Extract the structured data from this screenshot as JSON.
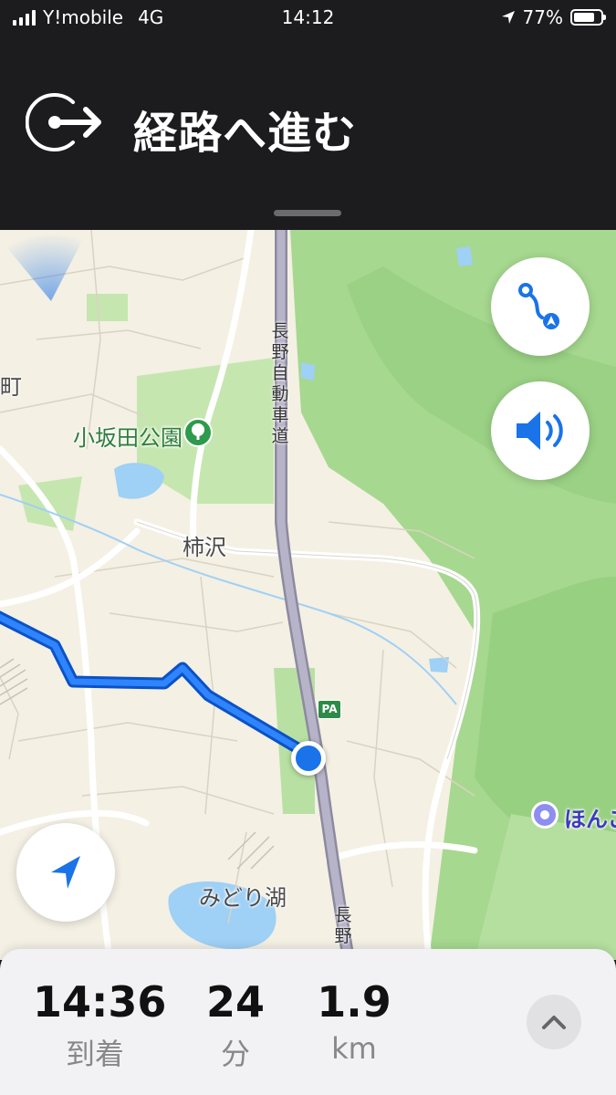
{
  "status_bar": {
    "carrier": "Y!mobile",
    "network": "4G",
    "time": "14:12",
    "battery_percent": "77%",
    "battery_level": 0.77
  },
  "navigation": {
    "instruction": "経路へ進む",
    "icon": "proceed-to-route-icon"
  },
  "map": {
    "labels": {
      "park": "小坂田公園",
      "area_kakizawa": "柿沢",
      "lake_midori": "みどり湖",
      "town_partial": "町",
      "expressway_1": "長野自動車道",
      "expressway_2": "長野",
      "poi_partial": "ほんご",
      "pa_badge": "PA"
    },
    "colors": {
      "route": "#1a73e8",
      "expressway": "#a9a5b8",
      "forest": "#a6d88f",
      "park": "#c6e6b0",
      "water": "#9fd0f5"
    }
  },
  "buttons": {
    "route_overview_icon": "route-overview-icon",
    "audio_icon": "speaker-icon",
    "locate_icon": "location-arrow-icon",
    "expand_icon": "chevron-up-icon"
  },
  "trip": {
    "arrival_time": "14:36",
    "arrival_label": "到着",
    "minutes": "24",
    "minutes_label": "分",
    "distance": "1.9",
    "distance_label": "km"
  }
}
